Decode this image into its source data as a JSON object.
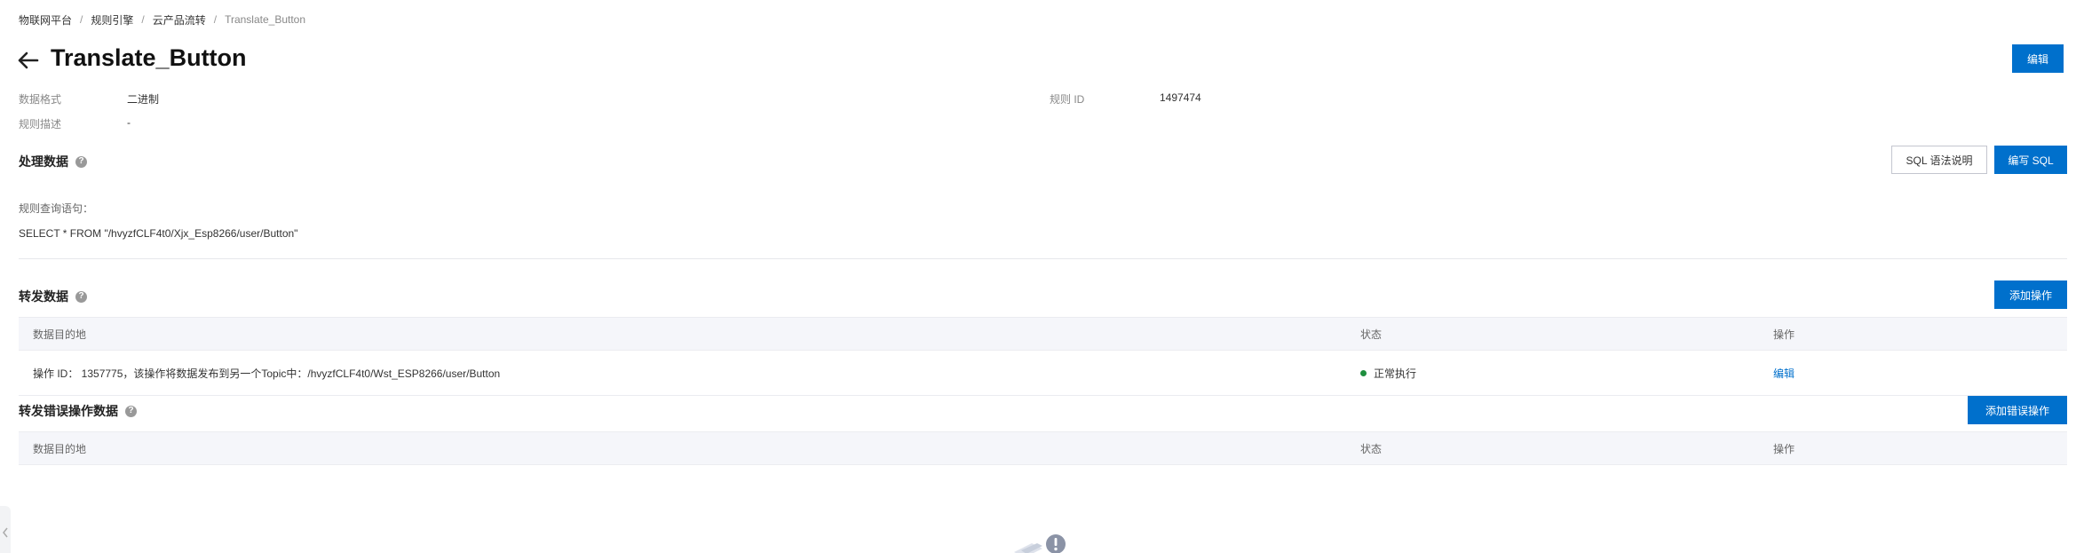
{
  "breadcrumb": {
    "items": [
      "物联网平台",
      "规则引擎",
      "云产品流转"
    ],
    "current": "Translate_Button",
    "separator": "/"
  },
  "header": {
    "title": "Translate_Button",
    "edit_button": "编辑"
  },
  "info": {
    "data_format_label": "数据格式",
    "data_format_value": "二进制",
    "rule_id_label": "规则 ID",
    "rule_id_value": "1497474",
    "rule_desc_label": "规则描述",
    "rule_desc_value": "-"
  },
  "process": {
    "title": "处理数据",
    "sql_help_button": "SQL 语法说明",
    "write_sql_button": "编写 SQL",
    "query_label": "规则查询语句：",
    "query_value": "SELECT * FROM \"/hvyzfCLF4t0/Xjx_Esp8266/user/Button\""
  },
  "forward": {
    "title": "转发数据",
    "add_button": "添加操作",
    "columns": [
      "数据目的地",
      "状态",
      "操作"
    ],
    "rows": [
      {
        "destination": "操作 ID： 1357775，该操作将数据发布到另一个Topic中：/hvyzfCLF4t0/Wst_ESP8266/user/Button",
        "status": "正常执行",
        "action": "编辑"
      }
    ]
  },
  "forward_error": {
    "title": "转发错误操作数据",
    "add_button": "添加错误操作",
    "columns": [
      "数据目的地",
      "状态",
      "操作"
    ]
  },
  "colors": {
    "primary": "#0070cc",
    "status_ok": "#1e8e3e",
    "table_header_bg": "#f5f6fa"
  },
  "icons": {
    "back": "arrow-left-icon",
    "help": "question-circle-icon",
    "empty": "empty-state-illustration",
    "collapse": "chevron-left-icon"
  }
}
